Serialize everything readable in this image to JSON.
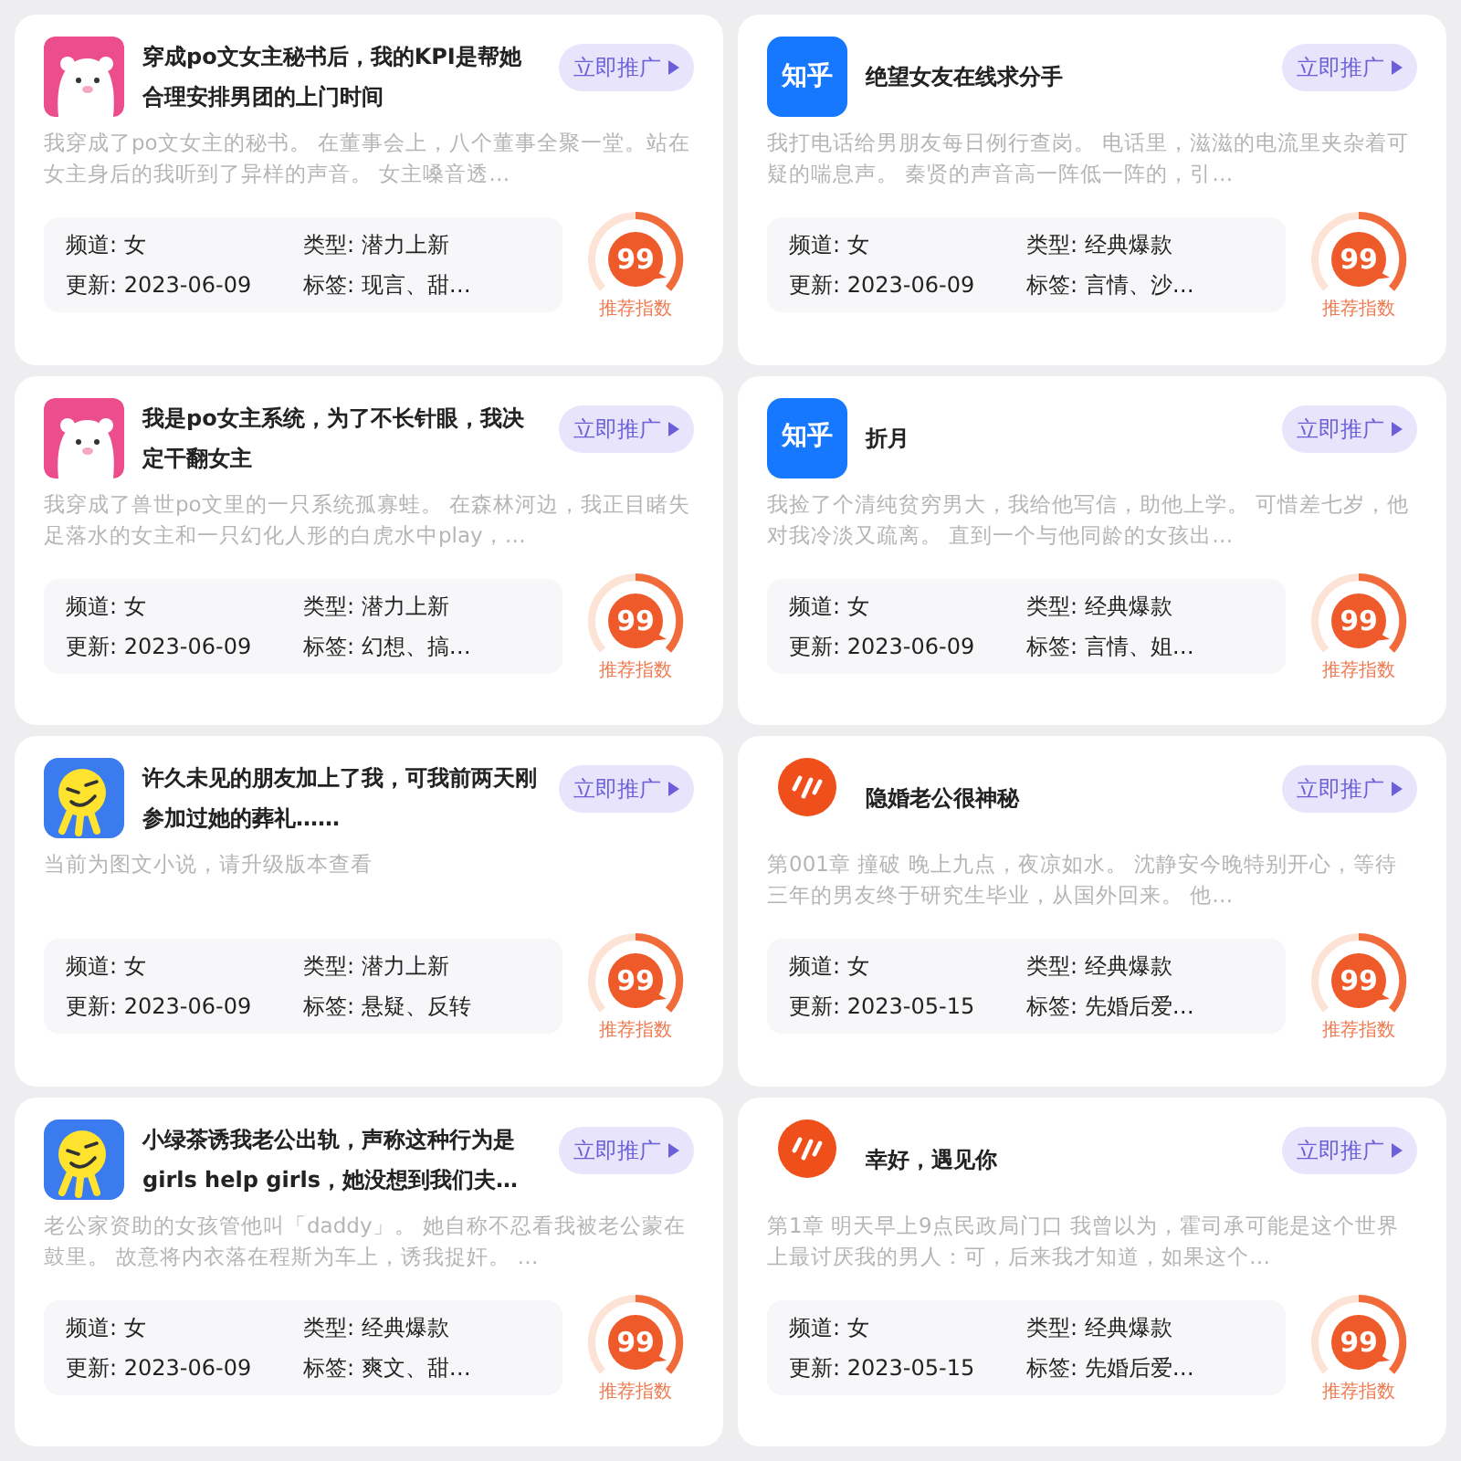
{
  "columns": [
    {
      "cards": [
        {
          "kind": "bear",
          "title": "穿成po文女主秘书后，我的KPI是帮她合理安排男团的上门时间",
          "button": "立即推广",
          "description": "我穿成了po文女主的秘书。 在董事会上，八个董事全聚一堂。站在女主身后的我听到了异样的声音。 女主嗓音透…",
          "channel_label": "频道:",
          "channel": "女",
          "type_label": "类型:",
          "type": "潜力上新",
          "updated_label": "更新:",
          "updated": "2023-06-09",
          "tags_label": "标签:",
          "tags": "现言、甜…",
          "score": "99",
          "score_caption": "推荐指数"
        },
        {
          "kind": "bear",
          "title": "我是po女主系统，为了不长针眼，我决定干翻女主",
          "button": "立即推广",
          "description": "我穿成了兽世po文里的一只系统孤寡蛙。 在森林河边，我正目睹失足落水的女主和一只幻化人形的白虎水中play，…",
          "channel_label": "频道:",
          "channel": "女",
          "type_label": "类型:",
          "type": "潜力上新",
          "updated_label": "更新:",
          "updated": "2023-06-09",
          "tags_label": "标签:",
          "tags": "幻想、搞…",
          "score": "99",
          "score_caption": "推荐指数"
        },
        {
          "kind": "blob",
          "title": "许久未见的朋友加上了我，可我前两天刚参加过她的葬礼……",
          "button": "立即推广",
          "description": "当前为图文小说，请升级版本查看",
          "channel_label": "频道:",
          "channel": "女",
          "type_label": "类型:",
          "type": "潜力上新",
          "updated_label": "更新:",
          "updated": "2023-06-09",
          "tags_label": "标签:",
          "tags": "悬疑、反转",
          "score": "99",
          "score_caption": "推荐指数"
        },
        {
          "kind": "blob",
          "title": "小绿茶诱我老公出轨，声称这种行为是girls help girls，她没想到我们夫…",
          "button": "立即推广",
          "description": "老公家资助的女孩管他叫「daddy」。 她自称不忍看我被老公蒙在鼓里。 故意将内衣落在程斯为车上，诱我捉奸。 …",
          "channel_label": "频道:",
          "channel": "女",
          "type_label": "类型:",
          "type": "经典爆款",
          "updated_label": "更新:",
          "updated": "2023-06-09",
          "tags_label": "标签:",
          "tags": "爽文、甜…",
          "score": "99",
          "score_caption": "推荐指数"
        }
      ]
    },
    {
      "cards": [
        {
          "kind": "zhihu",
          "app_text": "知乎",
          "title": "绝望女友在线求分手",
          "button": "立即推广",
          "description": "我打电话给男朋友每日例行查岗。 电话里，滋滋的电流里夹杂着可疑的喘息声。 秦贤的声音高一阵低一阵的，引…",
          "channel_label": "频道:",
          "channel": "女",
          "type_label": "类型:",
          "type": "经典爆款",
          "updated_label": "更新:",
          "updated": "2023-06-09",
          "tags_label": "标签:",
          "tags": "言情、沙…",
          "score": "99",
          "score_caption": "推荐指数"
        },
        {
          "kind": "zhihu",
          "app_text": "知乎",
          "title": "折月",
          "button": "立即推广",
          "description": "我捡了个清纯贫穷男大，我给他写信，助他上学。 可惜差七岁，他对我冷淡又疏离。 直到一个与他同龄的女孩出…",
          "channel_label": "频道:",
          "channel": "女",
          "type_label": "类型:",
          "type": "经典爆款",
          "updated_label": "更新:",
          "updated": "2023-06-09",
          "tags_label": "标签:",
          "tags": "言情、姐…",
          "score": "99",
          "score_caption": "推荐指数"
        },
        {
          "kind": "flame",
          "title": "隐婚老公很神秘",
          "button": "立即推广",
          "description": "第001章 撞破 晚上九点，夜凉如水。 沈静安今晚特别开心，等待三年的男友终于研究生毕业，从国外回来。 他…",
          "channel_label": "频道:",
          "channel": "女",
          "type_label": "类型:",
          "type": "经典爆款",
          "updated_label": "更新:",
          "updated": "2023-05-15",
          "tags_label": "标签:",
          "tags": "先婚后爱…",
          "score": "99",
          "score_caption": "推荐指数"
        },
        {
          "kind": "flame",
          "title": "幸好，遇见你",
          "button": "立即推广",
          "description": "第1章 明天早上9点民政局门口 我曾以为，霍司承可能是这个世界上最讨厌我的男人：可，后来我才知道，如果这个…",
          "channel_label": "频道:",
          "channel": "女",
          "type_label": "类型:",
          "type": "经典爆款",
          "updated_label": "更新:",
          "updated": "2023-05-15",
          "tags_label": "标签:",
          "tags": "先婚后爱…",
          "score": "99",
          "score_caption": "推荐指数"
        }
      ]
    }
  ]
}
